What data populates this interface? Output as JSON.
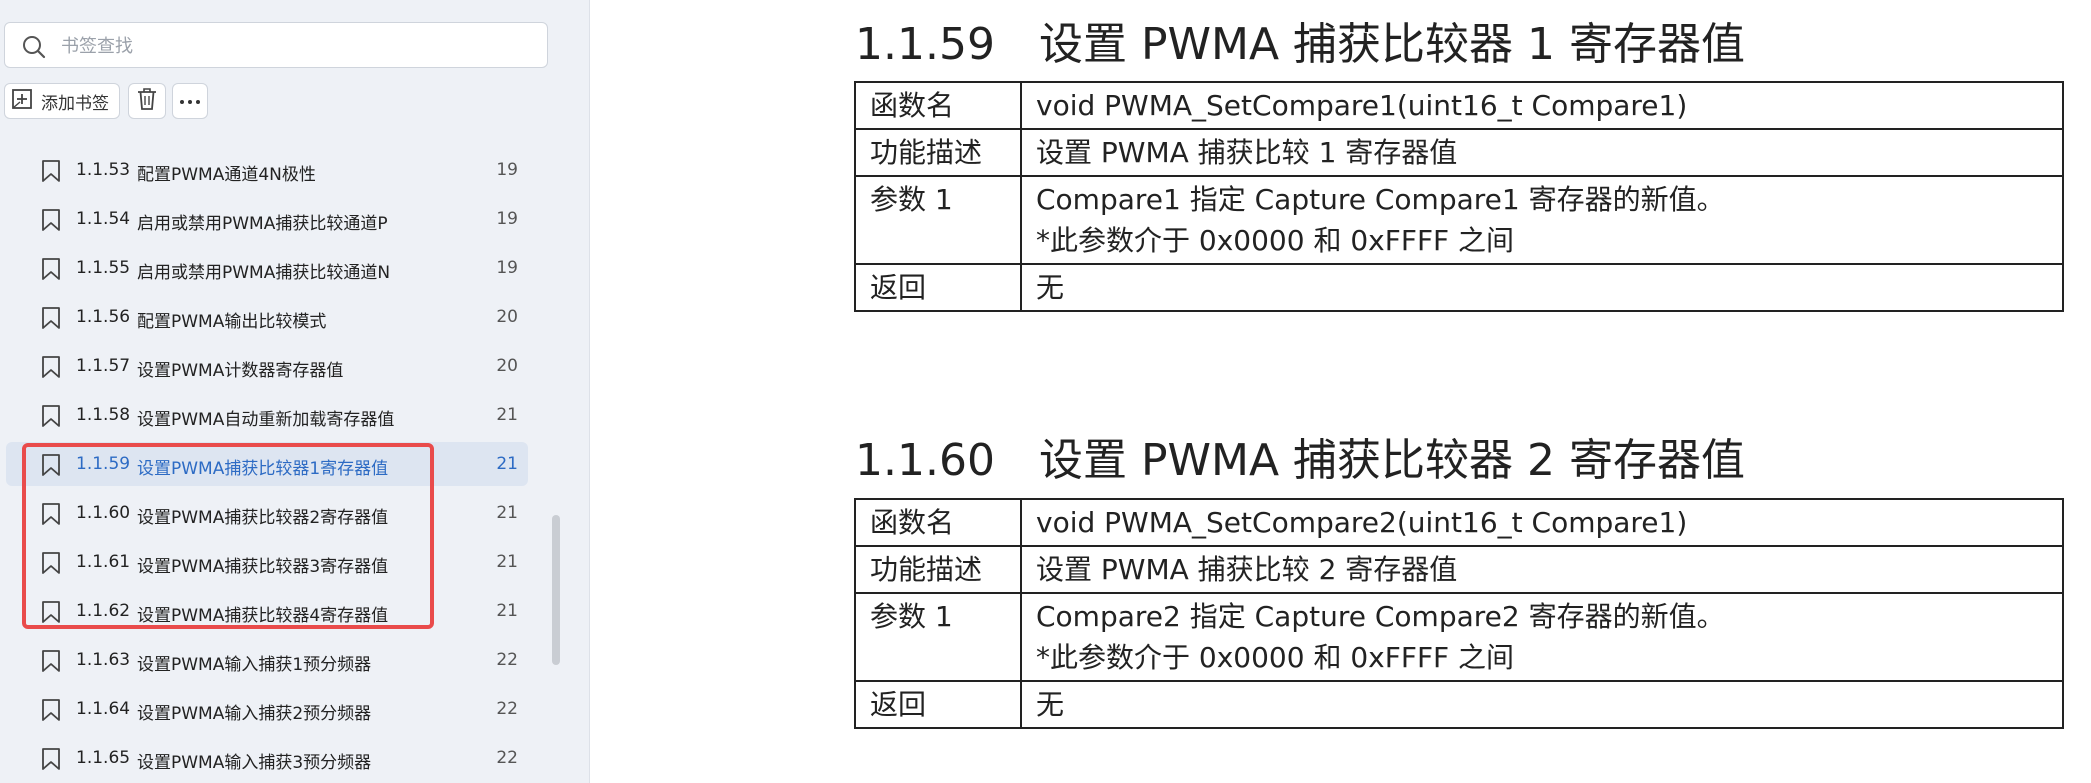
{
  "sidebar": {
    "search": {
      "placeholder": "书签查找"
    },
    "toolbar": {
      "add_label": "添加书签"
    },
    "bookmarks": [
      {
        "num": "1.1.53",
        "title": "配置PWMA通道4N极性",
        "page": "19"
      },
      {
        "num": "1.1.54",
        "title": "启用或禁用PWMA捕获比较通道P",
        "page": "19"
      },
      {
        "num": "1.1.55",
        "title": "启用或禁用PWMA捕获比较通道N",
        "page": "19"
      },
      {
        "num": "1.1.56",
        "title": "配置PWMA输出比较模式",
        "page": "20"
      },
      {
        "num": "1.1.57",
        "title": "设置PWMA计数器寄存器值",
        "page": "20"
      },
      {
        "num": "1.1.58",
        "title": "设置PWMA自动重新加载寄存器值",
        "page": "21"
      },
      {
        "num": "1.1.59",
        "title": "设置PWMA捕获比较器1寄存器值",
        "page": "21"
      },
      {
        "num": "1.1.60",
        "title": "设置PWMA捕获比较器2寄存器值",
        "page": "21"
      },
      {
        "num": "1.1.61",
        "title": "设置PWMA捕获比较器3寄存器值",
        "page": "21"
      },
      {
        "num": "1.1.62",
        "title": "设置PWMA捕获比较器4寄存器值",
        "page": "21"
      },
      {
        "num": "1.1.63",
        "title": "设置PWMA输入捕获1预分频器",
        "page": "22"
      },
      {
        "num": "1.1.64",
        "title": "设置PWMA输入捕获2预分频器",
        "page": "22"
      },
      {
        "num": "1.1.65",
        "title": "设置PWMA输入捕获3预分频器",
        "page": "22"
      }
    ],
    "active_index": 6,
    "highlight_color": "#e94b4b",
    "active_text_color": "#2d6bc4"
  },
  "document": {
    "sections": [
      {
        "num": "1.1.59",
        "title": "设置 PWMA 捕获比较器 1 寄存器值",
        "rows": [
          {
            "key": "函数名",
            "lines": [
              "void PWMA_SetCompare1(uint16_t Compare1)"
            ]
          },
          {
            "key": "功能描述",
            "lines": [
              "设置 PWMA 捕获比较 1 寄存器值"
            ]
          },
          {
            "key": "参数 1",
            "lines": [
              "Compare1 指定 Capture Compare1 寄存器的新值。",
              "*此参数介于 0x0000 和 0xFFFF 之间"
            ]
          },
          {
            "key": "返回",
            "lines": [
              "无"
            ]
          }
        ]
      },
      {
        "num": "1.1.60",
        "title": "设置 PWMA 捕获比较器 2 寄存器值",
        "rows": [
          {
            "key": "函数名",
            "lines": [
              "void PWMA_SetCompare2(uint16_t Compare1)"
            ]
          },
          {
            "key": "功能描述",
            "lines": [
              "设置 PWMA 捕获比较 2 寄存器值"
            ]
          },
          {
            "key": "参数 1",
            "lines": [
              "Compare2 指定 Capture Compare2 寄存器的新值。",
              "*此参数介于 0x0000 和 0xFFFF 之间"
            ]
          },
          {
            "key": "返回",
            "lines": [
              "无"
            ]
          }
        ]
      }
    ]
  }
}
